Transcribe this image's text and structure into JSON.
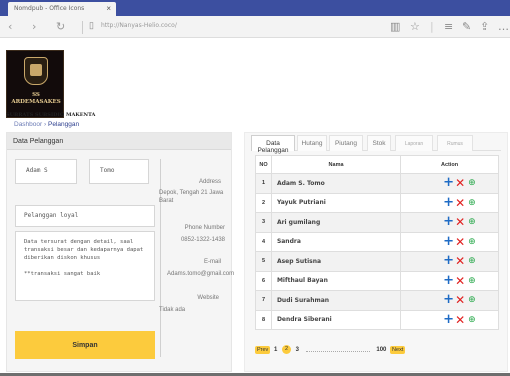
{
  "browser": {
    "tab_title": "Nomdpub - Office Icons",
    "tab_close": "×",
    "url": "http://Nanyas-Helio.coco/",
    "icons": [
      "back-arrow-icon",
      "forward-arrow-icon",
      "refresh-icon",
      "page-icon",
      "reading-view-icon",
      "favorite-star-icon",
      "hub-icon",
      "notes-icon",
      "share-icon",
      "more-icon"
    ]
  },
  "header": {
    "logo_text": "SS ARDEMASAKES",
    "tagline": "SUBRATS SUBSIDIO MAKENTA",
    "breadcrumb": {
      "home": "Dashboor",
      "separator": "›",
      "current": "Pelanggan"
    }
  },
  "form": {
    "title": "Data Pelanggan",
    "first_name": "Adam S",
    "last_name": "Tomo",
    "customer_type": "Pelanggan loyal",
    "notes_line1": "Data tersurat dengan detail, saal transaksi besar dan kedaparnya dapat diberikan diskon khusus",
    "notes_line2": "**transaksi sangat baik",
    "labels": {
      "address": "Address",
      "phone": "Phone Number",
      "email": "E-mail",
      "website": "Website"
    },
    "values": {
      "address": "Depok, Tengah 21 Jawa Barat",
      "phone": "0852-1322-1438",
      "email": "Adams.tomo@gmail.com",
      "website": "Tidak ada"
    },
    "save_label": "Simpan"
  },
  "tabs": [
    {
      "label": "Data Pelanggan",
      "active": true
    },
    {
      "label": "Hutang",
      "active": false
    },
    {
      "label": "Piutang",
      "active": false
    },
    {
      "label": "Stok",
      "active": false
    },
    {
      "label": "Laporan",
      "active": false
    },
    {
      "label": "Rumus",
      "active": false
    }
  ],
  "table": {
    "columns": [
      "NO",
      "Nama",
      "Action"
    ],
    "rows": [
      {
        "no": "1",
        "name": "Adam S. Tomo"
      },
      {
        "no": "2",
        "name": "Yayuk Putriani"
      },
      {
        "no": "3",
        "name": "Ari gumilang"
      },
      {
        "no": "4",
        "name": "Sandra"
      },
      {
        "no": "5",
        "name": "Asep Sutisna"
      },
      {
        "no": "6",
        "name": "Mifthaul Bayan"
      },
      {
        "no": "7",
        "name": "Dudi Surahman"
      },
      {
        "no": "8",
        "name": "Dendra Siberani"
      }
    ],
    "action_glyphs": {
      "add": "+",
      "delete": "✕",
      "view": "⊕"
    }
  },
  "pagination": {
    "prev": "Prev",
    "page1": "1",
    "page2": "2",
    "page3": "3",
    "last": "100",
    "next": "Next"
  },
  "colors": {
    "accent": "#fccb3d",
    "add": "#1e6bc5",
    "delete": "#e02020",
    "view": "#27a84a",
    "tabbar": "#3c4fa0"
  }
}
